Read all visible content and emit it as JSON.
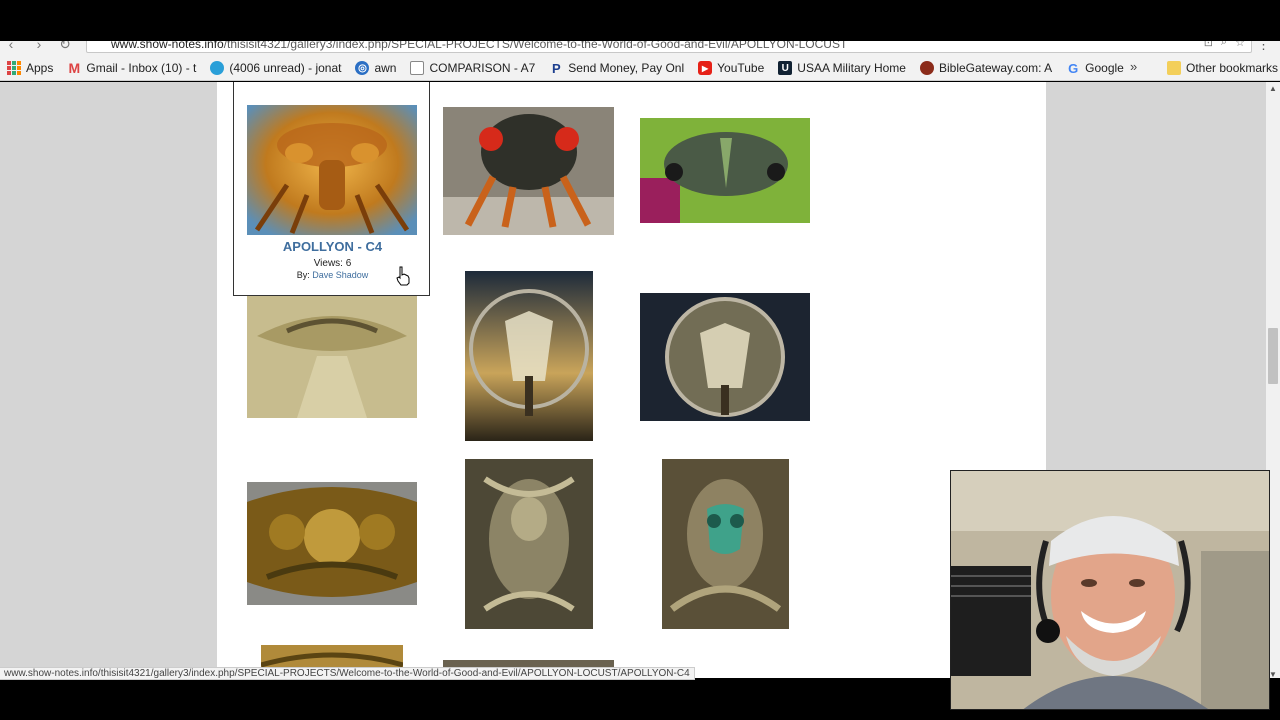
{
  "browser": {
    "url_host": "www.show-notes.info",
    "url_path": "/thisisit4321/gallery3/index.php/SPECIAL-PROJECTS/Welcome-to-the-World-of-Good-and-Evil/APOLLYON-LOCUST",
    "bookmarks": [
      {
        "label": "Apps",
        "icon": "apps-grid-icon"
      },
      {
        "label": "Gmail - Inbox (10) - t",
        "icon": "gmail-icon"
      },
      {
        "label": "(4006 unread) - jonat",
        "icon": "att-icon"
      },
      {
        "label": "awn",
        "icon": "globe-icon"
      },
      {
        "label": "COMPARISON - A7",
        "icon": "page-icon"
      },
      {
        "label": "Send Money, Pay Onl",
        "icon": "paypal-icon"
      },
      {
        "label": "YouTube",
        "icon": "youtube-icon"
      },
      {
        "label": "USAA Military Home",
        "icon": "usaa-icon"
      },
      {
        "label": "BibleGateway.com: A",
        "icon": "biblegateway-icon"
      },
      {
        "label": "Google",
        "icon": "google-icon"
      }
    ],
    "more_label": "»",
    "other_bookmarks": "Other bookmarks",
    "status_url": "www.show-notes.info/thisisit4321/gallery3/index.php/SPECIAL-PROJECTS/Welcome-to-the-World-of-Good-and-Evil/APOLLYON-LOCUST/APOLLYON-C4"
  },
  "gallery": {
    "hover_card": {
      "title": "APOLLYON - C4",
      "views": "Views: 6",
      "by_label": "By:",
      "author": "Dave Shadow"
    }
  },
  "colors": {
    "link": "#3f6e9e",
    "page_bg": "#d5d5d5",
    "content_bg": "#ffffff"
  }
}
